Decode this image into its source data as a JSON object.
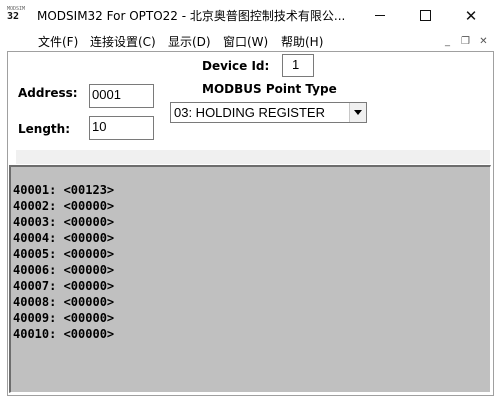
{
  "titlebar": {
    "icon_top": "MODSIM",
    "icon_bot": "32",
    "title": "MODSIM32 For OPTO22 - 北京奥普图控制技术有限公...",
    "min_glyph": "",
    "close_glyph": "✕"
  },
  "menu": {
    "items": [
      {
        "label": "文件(F)"
      },
      {
        "label": "连接设置(C)"
      },
      {
        "label": "显示(D)"
      },
      {
        "label": "窗口(W)"
      },
      {
        "label": "帮助(H)"
      }
    ],
    "mdi_min": "_",
    "mdi_restore": "❐",
    "mdi_close": "✕"
  },
  "form": {
    "device_id_label": "Device Id:",
    "device_id_value": "1",
    "point_type_label": "MODBUS Point Type",
    "point_type_value": "03: HOLDING REGISTER",
    "address_label": "Address:",
    "address_value": "0001",
    "length_label": "Length:",
    "length_value": "10"
  },
  "registers": [
    "40001: <00123>",
    "40002: <00000>",
    "40003: <00000>",
    "40004: <00000>",
    "40005: <00000>",
    "40006: <00000>",
    "40007: <00000>",
    "40008: <00000>",
    "40009: <00000>",
    "40010: <00000>"
  ],
  "colors": {
    "data_pane_bg": "#c0c0c0",
    "strip_bg": "#f0f0f0"
  }
}
